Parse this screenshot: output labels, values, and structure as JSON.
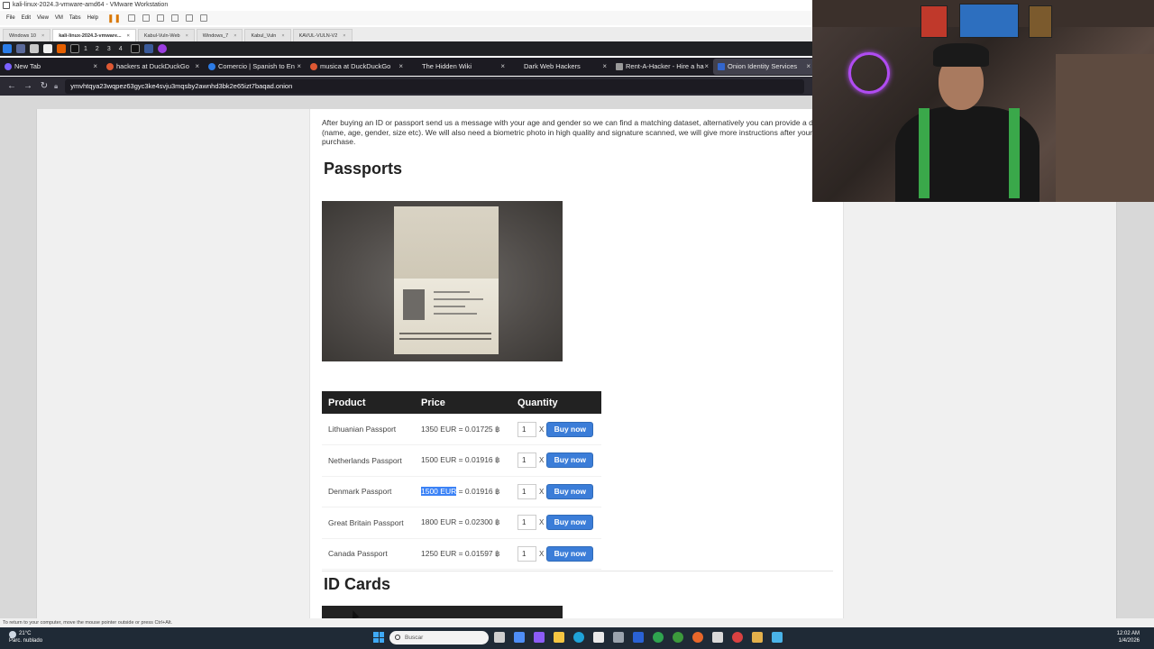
{
  "vmware": {
    "title": "kali-linux-2024.3-vmware-amd64 - VMware Workstation",
    "menu": [
      "File",
      "Edit",
      "View",
      "VM",
      "Tabs",
      "Help"
    ],
    "tabs": [
      "Windows 10",
      "kali-linux-2024.3-vmware...",
      "Kabul-Vuln-Web",
      "Windows_7",
      "Kabul_Vuln",
      "KAVUL-VULN-V2"
    ],
    "status_text": "To return to your computer, move the mouse pointer outside or press Ctrl+Alt."
  },
  "kali_panel": {
    "workspaces": [
      "1",
      "2",
      "3",
      "4"
    ]
  },
  "browser": {
    "tabs": [
      {
        "label": "New Tab",
        "color": "#7b61ff"
      },
      {
        "label": "hackers at DuckDuckGo",
        "color": "#de5833"
      },
      {
        "label": "Comercio | Spanish to En",
        "color": "#2c7be5"
      },
      {
        "label": "musica at DuckDuckGo",
        "color": "#de5833"
      },
      {
        "label": "The Hidden Wiki",
        "color": "#555555"
      },
      {
        "label": "Dark Web Hackers",
        "color": "#555555"
      },
      {
        "label": "Rent-A-Hacker - Hire a ha",
        "color": "#999999"
      },
      {
        "label": "Onion Identity Services",
        "color": "#3366cc"
      }
    ],
    "url": "ymvhtqya23wqpez63gyc3ke4svju3mqsby2awnhd3bk2e65izt7baqad.onion"
  },
  "page": {
    "intro": "After buying an ID or passport send us a message with your age and gender so we can find a matching dataset, alternatively you can provide a dataset (name, age, gender, size etc). We will also need a biometric photo in high quality and signature scanned, we will give more instructions after your purchase.",
    "passports_title": "Passports",
    "table_headers": [
      "Product",
      "Price",
      "Quantity"
    ],
    "products": [
      {
        "name": "Lithuanian Passport",
        "price_eur": "1350 EUR",
        "price_btc": "= 0.01725 ฿",
        "qty": "1",
        "button": "Buy now"
      },
      {
        "name": "Netherlands Passport",
        "price_eur": "1500 EUR",
        "price_btc": "= 0.01916 ฿",
        "qty": "1",
        "button": "Buy now"
      },
      {
        "name": "Denmark Passport",
        "price_eur": "1500 EUR",
        "price_btc": "= 0.01916 ฿",
        "qty": "1",
        "button": "Buy now"
      },
      {
        "name": "Great Britain Passport",
        "price_eur": "1800 EUR",
        "price_btc": "= 0.02300 ฿",
        "qty": "1",
        "button": "Buy now"
      },
      {
        "name": "Canada Passport",
        "price_eur": "1250 EUR",
        "price_btc": "= 0.01597 ฿",
        "qty": "1",
        "button": "Buy now"
      }
    ],
    "qty_sep": "X",
    "idcards_title": "ID Cards"
  },
  "taskbar": {
    "weather_temp": "21°C",
    "weather_desc": "Parc. nublado",
    "search_placeholder": "Buscar",
    "time": "12:02 AM",
    "date": "1/4/2026"
  }
}
